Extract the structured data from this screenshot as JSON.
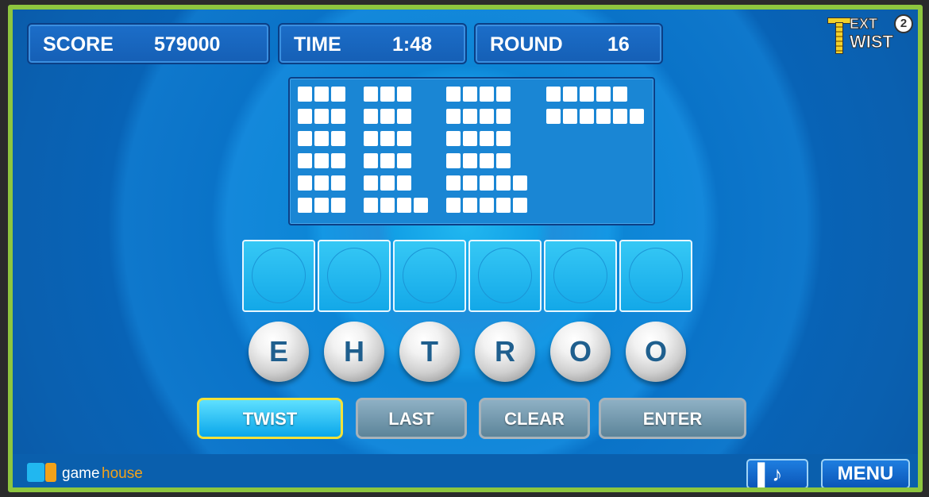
{
  "hud": {
    "score_label": "SCORE",
    "score_value": "579000",
    "time_label": "TIME",
    "time_value": "1:48",
    "round_label": "ROUND",
    "round_value": "16"
  },
  "logo": {
    "line1": "EXT",
    "line2": "WIST",
    "badge": "2"
  },
  "word_board": {
    "columns": [
      {
        "word_lengths": [
          3,
          3,
          3,
          3,
          3,
          3
        ]
      },
      {
        "word_lengths": [
          3,
          3,
          3,
          3,
          3,
          4
        ]
      },
      {
        "word_lengths": [
          4,
          4,
          4,
          4,
          5,
          5
        ]
      },
      {
        "word_lengths": [
          5,
          6
        ]
      }
    ]
  },
  "answer_slots": 6,
  "letters": [
    "E",
    "H",
    "T",
    "R",
    "O",
    "O"
  ],
  "buttons": {
    "twist": "TWIST",
    "last": "LAST",
    "clear": "CLEAR",
    "enter": "ENTER"
  },
  "footer": {
    "brand_game": "game",
    "brand_house": "house",
    "menu": "MENU"
  },
  "icons": [
    "gamehouse-logo-icon",
    "sound-toggle-icon"
  ],
  "colors": {
    "frame": "#8ec63f",
    "accent_button_border": "#f2e23a",
    "letter": "#1f5f8e"
  }
}
